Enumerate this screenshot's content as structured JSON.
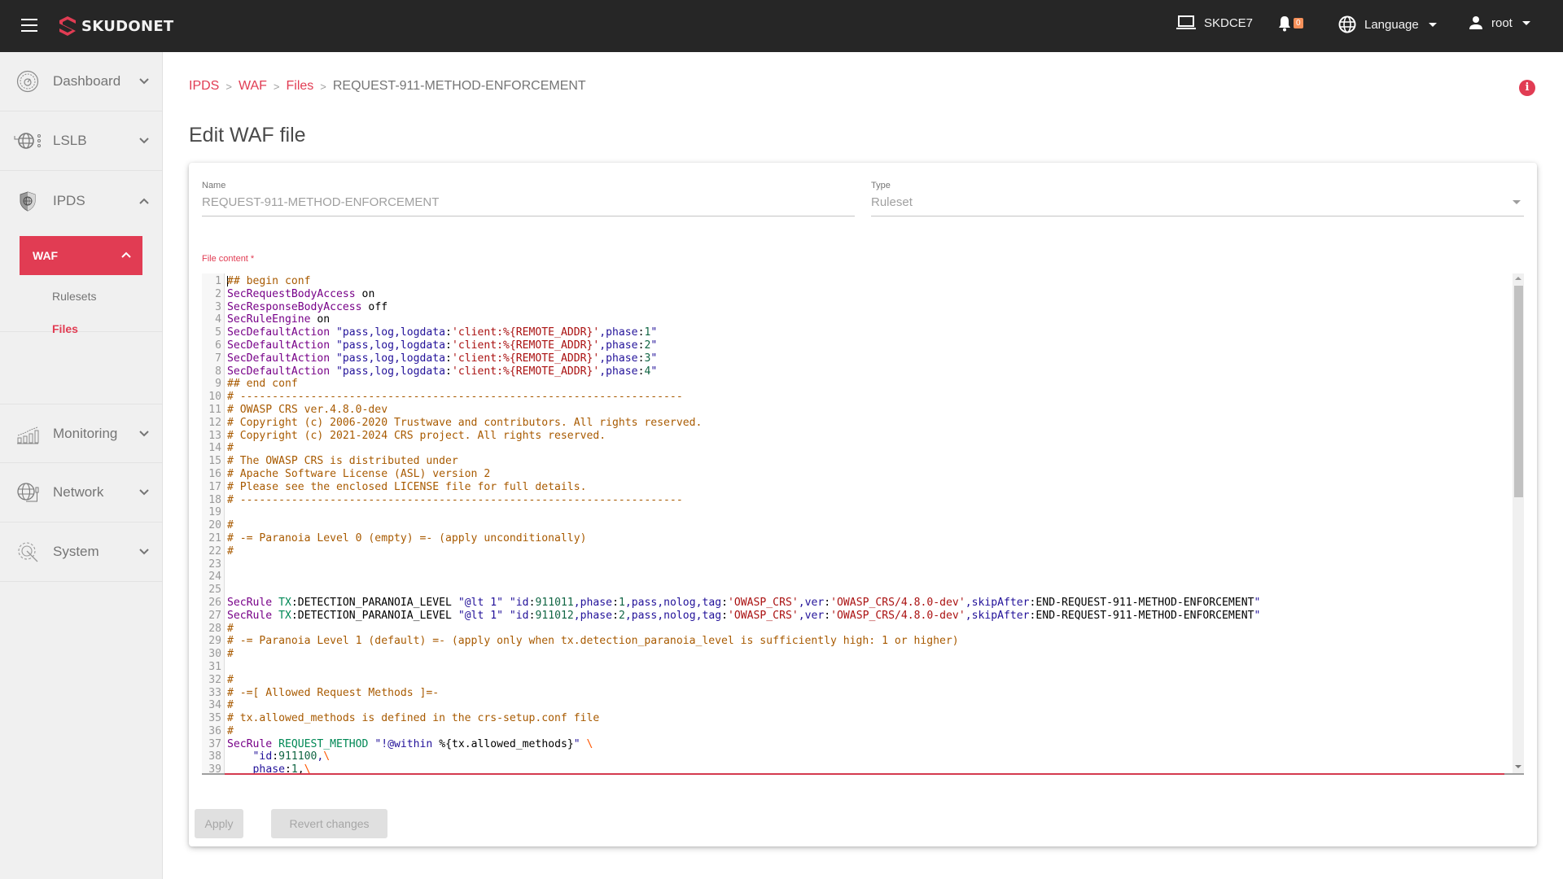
{
  "topbar": {
    "brand": "SKUDONET",
    "host": "SKDCE7",
    "notifications_count": "0",
    "language_label": "Language",
    "user_label": "root",
    "colors": {
      "background": "#262626",
      "brand_accent": "#e13c53",
      "badge": "#f7915a"
    }
  },
  "sidebar": {
    "items": [
      {
        "label": "Dashboard",
        "icon": "dashboard-gauge-icon",
        "expanded": false
      },
      {
        "label": "LSLB",
        "icon": "lslb-globe-icon",
        "expanded": false
      },
      {
        "label": "IPDS",
        "icon": "ipds-shield-icon",
        "expanded": true
      },
      {
        "label": "Monitoring",
        "icon": "monitoring-chart-icon",
        "expanded": false
      },
      {
        "label": "Network",
        "icon": "network-globe-icon",
        "expanded": false
      },
      {
        "label": "System",
        "icon": "system-gear-icon",
        "expanded": false
      }
    ],
    "ipds_sub": {
      "label": "WAF",
      "expanded": true
    },
    "waf_sub": [
      {
        "label": "Rulesets",
        "active": false
      },
      {
        "label": "Files",
        "active": true
      }
    ]
  },
  "breadcrumb": {
    "items": [
      "IPDS",
      "WAF",
      "Files"
    ],
    "current": "REQUEST-911-METHOD-ENFORCEMENT",
    "separator": ">"
  },
  "page": {
    "title": "Edit WAF file"
  },
  "form": {
    "name_label": "Name",
    "name_value": "REQUEST-911-METHOD-ENFORCEMENT",
    "type_label": "Type",
    "type_value": "Ruleset",
    "content_label": "File content *"
  },
  "editor": {
    "lines": [
      [
        [
          "c",
          "## begin conf"
        ]
      ],
      [
        [
          "d",
          "SecRequestBodyAccess"
        ],
        [
          "p",
          " on"
        ]
      ],
      [
        [
          "d",
          "SecResponseBodyAccess"
        ],
        [
          "p",
          " off"
        ]
      ],
      [
        [
          "d",
          "SecRuleEngine"
        ],
        [
          "p",
          " on"
        ]
      ],
      [
        [
          "d",
          "SecDefaultAction"
        ],
        [
          "p",
          " "
        ],
        [
          "s",
          "\"pass,log,logdata"
        ],
        [
          "p",
          ":"
        ],
        [
          "q",
          "'client:%{REMOTE_ADDR}'"
        ],
        [
          "s",
          ",phase"
        ],
        [
          "p",
          ":"
        ],
        [
          "n",
          "1"
        ],
        [
          "s",
          "\""
        ]
      ],
      [
        [
          "d",
          "SecDefaultAction"
        ],
        [
          "p",
          " "
        ],
        [
          "s",
          "\"pass,log,logdata"
        ],
        [
          "p",
          ":"
        ],
        [
          "q",
          "'client:%{REMOTE_ADDR}'"
        ],
        [
          "s",
          ",phase"
        ],
        [
          "p",
          ":"
        ],
        [
          "n",
          "2"
        ],
        [
          "s",
          "\""
        ]
      ],
      [
        [
          "d",
          "SecDefaultAction"
        ],
        [
          "p",
          " "
        ],
        [
          "s",
          "\"pass,log,logdata"
        ],
        [
          "p",
          ":"
        ],
        [
          "q",
          "'client:%{REMOTE_ADDR}'"
        ],
        [
          "s",
          ",phase"
        ],
        [
          "p",
          ":"
        ],
        [
          "n",
          "3"
        ],
        [
          "s",
          "\""
        ]
      ],
      [
        [
          "d",
          "SecDefaultAction"
        ],
        [
          "p",
          " "
        ],
        [
          "s",
          "\"pass,log,logdata"
        ],
        [
          "p",
          ":"
        ],
        [
          "q",
          "'client:%{REMOTE_ADDR}'"
        ],
        [
          "s",
          ",phase"
        ],
        [
          "p",
          ":"
        ],
        [
          "n",
          "4"
        ],
        [
          "s",
          "\""
        ]
      ],
      [
        [
          "c",
          "## end conf"
        ]
      ],
      [
        [
          "c",
          "# ---------------------------------------------------------------------"
        ]
      ],
      [
        [
          "c",
          "# OWASP CRS ver.4.8.0-dev"
        ]
      ],
      [
        [
          "c",
          "# Copyright (c) 2006-2020 Trustwave and contributors. All rights reserved."
        ]
      ],
      [
        [
          "c",
          "# Copyright (c) 2021-2024 CRS project. All rights reserved."
        ]
      ],
      [
        [
          "c",
          "#"
        ]
      ],
      [
        [
          "c",
          "# The OWASP CRS is distributed under"
        ]
      ],
      [
        [
          "c",
          "# Apache Software License (ASL) version 2"
        ]
      ],
      [
        [
          "c",
          "# Please see the enclosed LICENSE file for full details."
        ]
      ],
      [
        [
          "c",
          "# ---------------------------------------------------------------------"
        ]
      ],
      [],
      [
        [
          "c",
          "#"
        ]
      ],
      [
        [
          "c",
          "# -= Paranoia Level 0 (empty) =- (apply unconditionally)"
        ]
      ],
      [
        [
          "c",
          "#"
        ]
      ],
      [],
      [],
      [],
      [
        [
          "d",
          "SecRule"
        ],
        [
          "p",
          " "
        ],
        [
          "v",
          "TX"
        ],
        [
          "p",
          ":DETECTION_PARANOIA_LEVEL "
        ],
        [
          "s",
          "\"@lt 1\""
        ],
        [
          "p",
          " "
        ],
        [
          "s",
          "\"id"
        ],
        [
          "p",
          ":"
        ],
        [
          "n",
          "911011"
        ],
        [
          "s",
          ",phase"
        ],
        [
          "p",
          ":"
        ],
        [
          "n",
          "1"
        ],
        [
          "s",
          ",pass,nolog,tag"
        ],
        [
          "p",
          ":"
        ],
        [
          "q",
          "'OWASP_CRS'"
        ],
        [
          "s",
          ",ver"
        ],
        [
          "p",
          ":"
        ],
        [
          "q",
          "'OWASP_CRS/4.8.0-dev'"
        ],
        [
          "s",
          ",skipAfter"
        ],
        [
          "p",
          ":END-REQUEST-911-METHOD-ENFORCEMENT"
        ],
        [
          "s",
          "\""
        ]
      ],
      [
        [
          "d",
          "SecRule"
        ],
        [
          "p",
          " "
        ],
        [
          "v",
          "TX"
        ],
        [
          "p",
          ":DETECTION_PARANOIA_LEVEL "
        ],
        [
          "s",
          "\"@lt 1\""
        ],
        [
          "p",
          " "
        ],
        [
          "s",
          "\"id"
        ],
        [
          "p",
          ":"
        ],
        [
          "n",
          "911012"
        ],
        [
          "s",
          ",phase"
        ],
        [
          "p",
          ":"
        ],
        [
          "n",
          "2"
        ],
        [
          "s",
          ",pass,nolog,tag"
        ],
        [
          "p",
          ":"
        ],
        [
          "q",
          "'OWASP_CRS'"
        ],
        [
          "s",
          ",ver"
        ],
        [
          "p",
          ":"
        ],
        [
          "q",
          "'OWASP_CRS/4.8.0-dev'"
        ],
        [
          "s",
          ",skipAfter"
        ],
        [
          "p",
          ":END-REQUEST-911-METHOD-ENFORCEMENT"
        ],
        [
          "s",
          "\""
        ]
      ],
      [
        [
          "c",
          "#"
        ]
      ],
      [
        [
          "c",
          "# -= Paranoia Level 1 (default) =- (apply only when tx.detection_paranoia_level is sufficiently high: 1 or higher)"
        ]
      ],
      [
        [
          "c",
          "#"
        ]
      ],
      [],
      [
        [
          "c",
          "#"
        ]
      ],
      [
        [
          "c",
          "# -=[ Allowed Request Methods ]=-"
        ]
      ],
      [
        [
          "c",
          "#"
        ]
      ],
      [
        [
          "c",
          "# tx.allowed_methods is defined in the crs-setup.conf file"
        ]
      ],
      [
        [
          "c",
          "#"
        ]
      ],
      [
        [
          "d",
          "SecRule"
        ],
        [
          "p",
          " "
        ],
        [
          "v",
          "REQUEST_METHOD"
        ],
        [
          "p",
          " "
        ],
        [
          "s",
          "\"!@within "
        ],
        [
          "p",
          "%{tx.allowed_methods}"
        ],
        [
          "s",
          "\""
        ],
        [
          "p",
          " "
        ],
        [
          "e",
          "\\"
        ]
      ],
      [
        [
          "p",
          "    "
        ],
        [
          "s",
          "\"id"
        ],
        [
          "p",
          ":"
        ],
        [
          "n",
          "911100"
        ],
        [
          "s",
          ","
        ],
        [
          "e",
          "\\"
        ]
      ],
      [
        [
          "p",
          "    "
        ],
        [
          "s",
          "phase"
        ],
        [
          "p",
          ":"
        ],
        [
          "n",
          "1"
        ],
        [
          "p",
          ","
        ],
        [
          "e",
          "\\"
        ]
      ]
    ],
    "scroll_fraction": 0.0
  },
  "actions": {
    "apply_label": "Apply",
    "revert_label": "Revert changes"
  }
}
